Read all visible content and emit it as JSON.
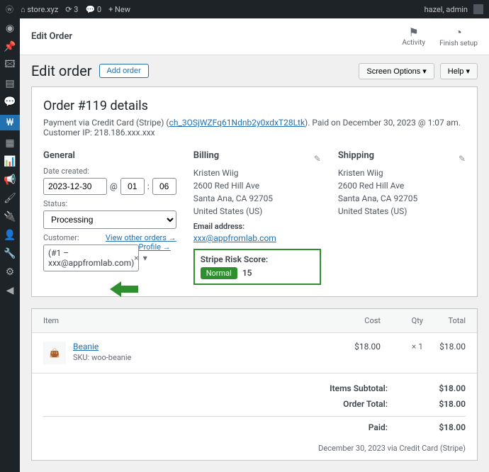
{
  "topbar": {
    "site": "store.xyz",
    "updates": "3",
    "comments": "0",
    "new": "New",
    "greet": "hazel, admin"
  },
  "header": {
    "pageTitle": "Edit Order",
    "activity": "Activity",
    "finish": "Finish setup"
  },
  "titlebar": {
    "heading": "Edit order",
    "addBtn": "Add order",
    "screenOptions": "Screen Options",
    "help": "Help"
  },
  "order": {
    "title": "Order #119 details",
    "payPrefix": "Payment via Credit Card (Stripe) (",
    "chLink": "ch_3OSjWZFq61Ndnb2y0xdxT28Ltk",
    "paySuffix": "). Paid on December 30, 2023 @ 1:07 am. Customer IP: 218.186.xxx.xxx"
  },
  "general": {
    "heading": "General",
    "dateLabel": "Date created:",
    "date": "2023-12-30",
    "at": "@",
    "hour": "01",
    "minute": "06",
    "statusLabel": "Status:",
    "status": "Processing",
    "customerLabel": "Customer:",
    "profileLink": "Profile →",
    "otherOrdersLink": "View other orders →",
    "customerValue": "(#1 – xxx@appfromlab.com)"
  },
  "billing": {
    "heading": "Billing",
    "name": "Kristen Wiig",
    "street": "2600 Red Hill Ave",
    "city": "Santa Ana, CA 92705",
    "country": "United States (US)",
    "emailLabel": "Email address:",
    "email": "xxx@appfromlab.com",
    "riskLabel": "Stripe Risk Score:",
    "riskLevel": "Normal",
    "riskScore": "15"
  },
  "shipping": {
    "heading": "Shipping",
    "name": "Kristen Wiig",
    "street": "2600 Red Hill Ave",
    "city": "Santa Ana, CA 92705",
    "country": "United States (US)"
  },
  "items": {
    "hdrItem": "Item",
    "hdrCost": "Cost",
    "hdrQty": "Qty",
    "hdrTotal": "Total",
    "row": {
      "name": "Beanie",
      "sku": "SKU: woo-beanie",
      "cost": "$18.00",
      "qty": "× 1",
      "total": "$18.00"
    }
  },
  "totals": {
    "subtotalLabel": "Items Subtotal:",
    "subtotalVal": "$18.00",
    "orderTotalLabel": "Order Total:",
    "orderTotalVal": "$18.00",
    "paidLabel": "Paid:",
    "paidVal": "$18.00",
    "paidNote": "December 30, 2023 via Credit Card (Stripe)"
  }
}
